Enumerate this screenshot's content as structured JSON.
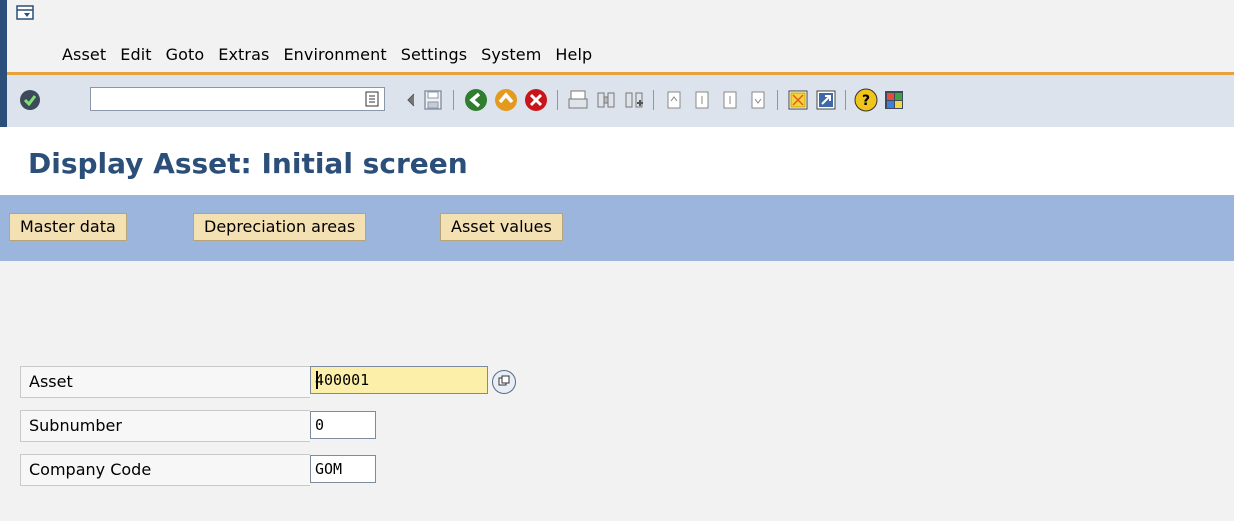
{
  "menu": {
    "items": [
      "Asset",
      "Edit",
      "Goto",
      "Extras",
      "Environment",
      "Settings",
      "System",
      "Help"
    ]
  },
  "toolbar": {
    "command_field_value": "",
    "buttons": [
      "enter",
      "back",
      "exit",
      "cancel",
      "print",
      "find",
      "find-next",
      "first-page",
      "previous-page",
      "next-page",
      "last-page",
      "create-session",
      "create-shortcut",
      "help",
      "customize-layout"
    ]
  },
  "page": {
    "title": "Display Asset: Initial screen"
  },
  "app_toolbar": {
    "master_data": "Master data",
    "depreciation_areas": "Depreciation areas",
    "asset_values": "Asset values"
  },
  "form": {
    "asset_label": "Asset",
    "asset_value": "400001",
    "subnumber_label": "Subnumber",
    "subnumber_value": "0",
    "company_code_label": "Company Code",
    "company_code_value": "GOM"
  },
  "colors": {
    "title": "#2b4f79",
    "accent_line": "#e8a23a",
    "app_bar": "#9bb5dc",
    "button_fill": "#f3e1b3",
    "required_field": "#fcefa9"
  }
}
